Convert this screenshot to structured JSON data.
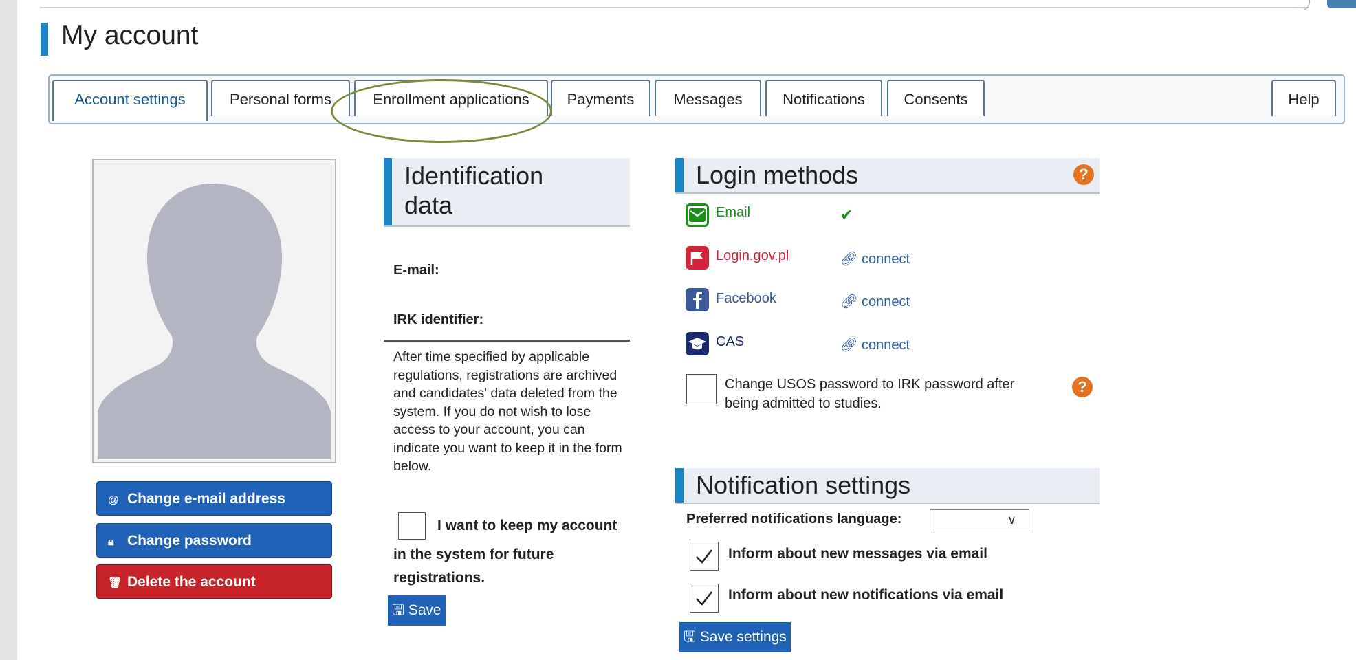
{
  "page": {
    "title": "My account"
  },
  "tabs": [
    {
      "label": "Account settings"
    },
    {
      "label": "Personal forms"
    },
    {
      "label": "Enrollment applications"
    },
    {
      "label": "Payments"
    },
    {
      "label": "Messages"
    },
    {
      "label": "Notifications"
    },
    {
      "label": "Consents"
    },
    {
      "label": "Help"
    }
  ],
  "profile": {
    "buttons": {
      "change_email": "Change e-mail address",
      "change_password": "Change password",
      "delete_account": "Delete the account"
    }
  },
  "identification": {
    "heading_line1": "Identification",
    "heading_line2": "data",
    "email_label": "E-mail:",
    "irk_label": "IRK identifier:",
    "archive_note": "After time specified by applicable regulations, registrations are archived and candidates' data deleted from the system. If you do not wish to lose access to your account, you can indicate you want to keep it in the form below.",
    "keep_account_line1": "I want to keep my account",
    "keep_account_line2": "in the system for future",
    "keep_account_line3": "registrations.",
    "keep_account_checked": false,
    "save_label": "Save"
  },
  "login_methods": {
    "heading": "Login methods",
    "items": [
      {
        "name": "Email",
        "status": "connected",
        "color": "#1a8f1a"
      },
      {
        "name": "Login.gov.pl",
        "action": "connect",
        "color": "#d0243a"
      },
      {
        "name": "Facebook",
        "action": "connect",
        "color": "#3b5998"
      },
      {
        "name": "CAS",
        "action": "connect",
        "color": "#1c2a6e"
      }
    ],
    "usos_option_line1": "Change USOS password to IRK password after",
    "usos_option_line2": "being admitted to studies.",
    "usos_option_checked": false
  },
  "notification_settings": {
    "heading": "Notification settings",
    "language_label": "Preferred notifications language:",
    "language_value": "",
    "inform_messages": "Inform about new messages via email",
    "inform_messages_checked": true,
    "inform_notifications": "Inform about new notifications via email",
    "inform_notifications_checked": true,
    "save_label": "Save settings"
  },
  "colors": {
    "accent_blue": "#1a84c8",
    "button_blue": "#2062b8",
    "button_red": "#c9232a",
    "help_orange": "#e37320",
    "highlight_ellipse": "#7d8a3a"
  }
}
